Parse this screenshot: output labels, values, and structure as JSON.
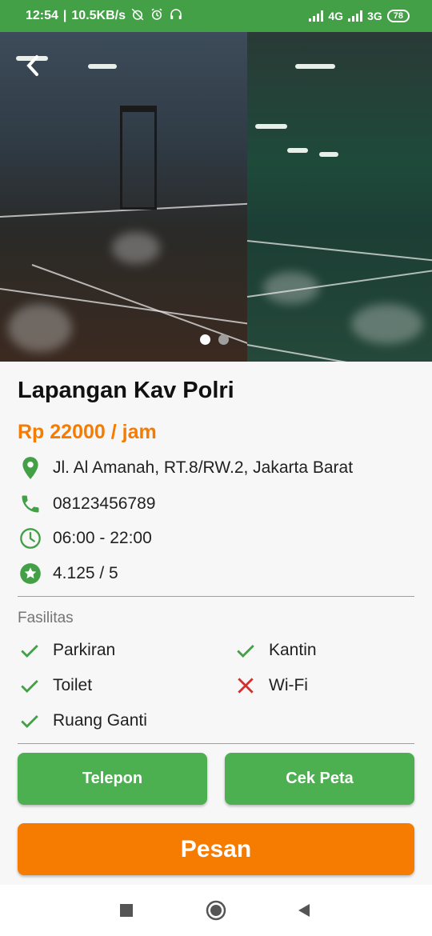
{
  "status_bar": {
    "time": "12:54",
    "net_speed": "10.5KB/s",
    "network_1": "4G",
    "network_2": "3G",
    "battery": "78",
    "icons": [
      "alarm-off-icon",
      "alarm-icon",
      "headphones-icon",
      "signal-icon",
      "signal-icon"
    ]
  },
  "gallery": {
    "page_count": 2,
    "active_page": 1
  },
  "venue": {
    "name": "Lapangan Kav Polri",
    "price": "Rp 22000 / jam",
    "address": "Jl. Al Amanah, RT.8/RW.2, Jakarta Barat",
    "phone": "08123456789",
    "hours": "06:00 - 22:00",
    "rating": "4.125 / 5"
  },
  "facilities": {
    "label": "Fasilitas",
    "items": [
      {
        "name": "Parkiran",
        "available": true
      },
      {
        "name": "Kantin",
        "available": true
      },
      {
        "name": "Toilet",
        "available": true
      },
      {
        "name": "Wi-Fi",
        "available": false
      },
      {
        "name": "Ruang Ganti",
        "available": true
      }
    ]
  },
  "actions": {
    "call_label": "Telepon",
    "map_label": "Cek Peta",
    "book_label": "Pesan"
  },
  "colors": {
    "primary_green": "#4caf50",
    "status_green": "#43a047",
    "accent_orange": "#f57c00",
    "unavailable_red": "#d32f2f"
  }
}
